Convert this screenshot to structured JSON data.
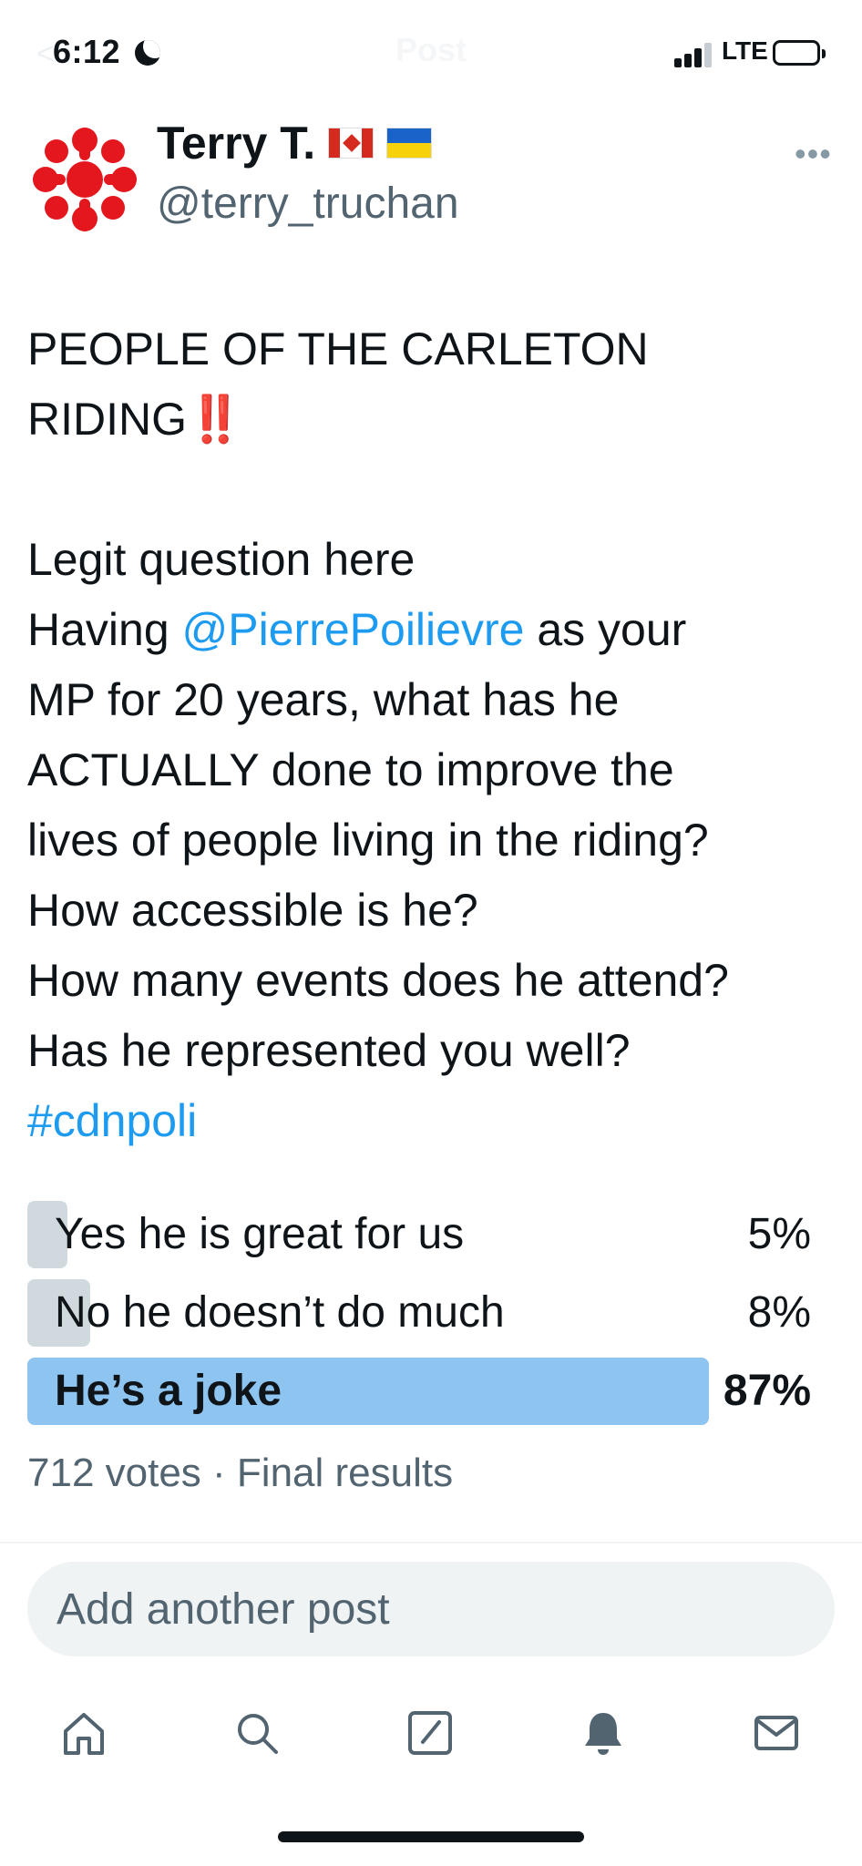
{
  "status_bar": {
    "time": "6:12",
    "back_label": "<",
    "title": "Post",
    "network": "LTE"
  },
  "author": {
    "name": "Terry T.",
    "handle": "@terry_truchan"
  },
  "tweet": {
    "heading_line1": "PEOPLE OF THE CARLETON",
    "heading_line2": "RIDING",
    "heading_emphasis": "‼️",
    "line_legit": "Legit question here",
    "having_prefix": "Having ",
    "mention": "@PierrePoilievre",
    "having_suffix": " as your",
    "line_mp": "MP for 20 years, what has he",
    "line_actually": "ACTUALLY done to improve the",
    "line_lives": "lives of people living in the riding?",
    "line_accessible": "How accessible is he?",
    "line_events": "How many events does he attend?",
    "line_represented": "Has he represented you well?",
    "hashtag": "#cdnpoli"
  },
  "poll": {
    "options": [
      {
        "label": "Yes he is great for us",
        "percent_text": "5%",
        "percent": 5,
        "winner": false
      },
      {
        "label": "No he doesn’t do much",
        "percent_text": "8%",
        "percent": 8,
        "winner": false
      },
      {
        "label": "He’s a joke",
        "percent_text": "87%",
        "percent": 87,
        "winner": true
      }
    ],
    "votes": "712 votes",
    "separator": " · ",
    "status": "Final results"
  },
  "reply": {
    "placeholder": "Add another post"
  },
  "nav": {
    "items": [
      "home-icon",
      "search-icon",
      "compose-icon",
      "notifications-icon",
      "messages-icon"
    ]
  },
  "colors": {
    "accent": "#1d9bf0",
    "poll_winner": "#8ec4f0",
    "poll_other": "#cfd9de",
    "secondary_text": "#536471"
  }
}
